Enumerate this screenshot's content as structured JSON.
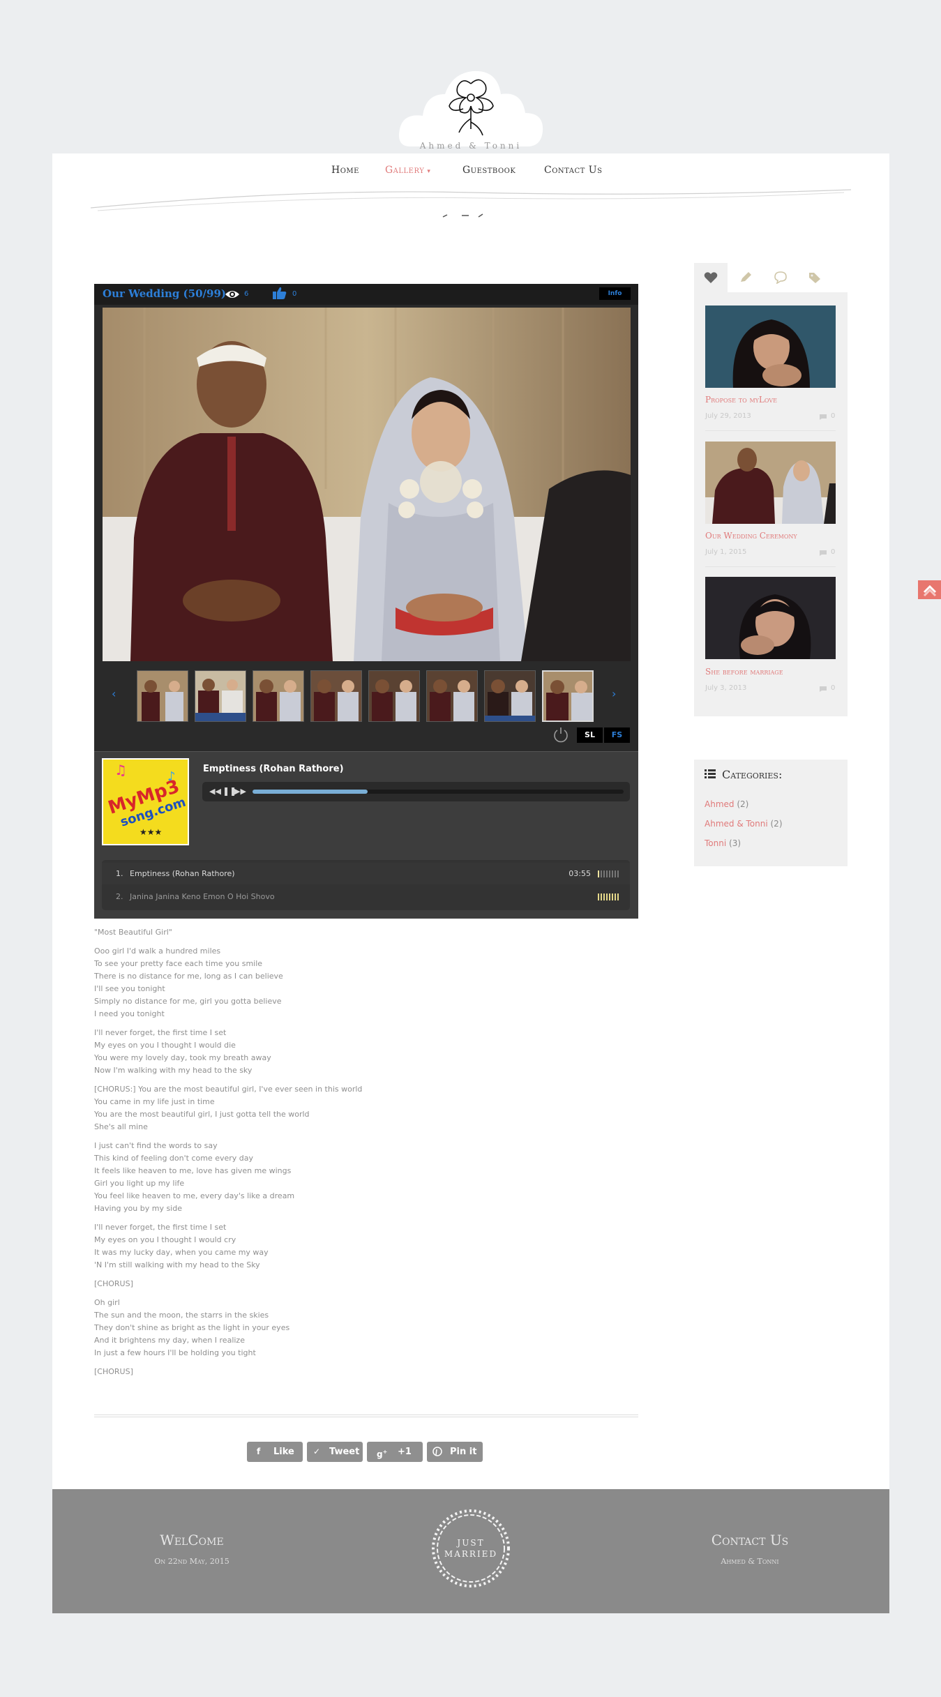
{
  "header": {
    "logo_text": "Ahmed & Tonni"
  },
  "nav": {
    "items": [
      {
        "label": "Home"
      },
      {
        "label": "Gallery"
      },
      {
        "label": "Guestbook"
      },
      {
        "label": "Contact Us"
      }
    ],
    "active_item": "Gallery"
  },
  "gallery": {
    "title": "Our Wedding (50/99)",
    "views": "6",
    "likes": "0",
    "info_label": "Info",
    "slideshow_label": "SL",
    "fullscreen_label": "FS",
    "thumbnail_count": 8,
    "active_thumbnail": 8
  },
  "player": {
    "current_track": "Emptiness (Rohan Rathore)",
    "album_art_text": "MyMp3song.com",
    "progress": 0.31,
    "playlist": [
      {
        "num": "1.",
        "name": "Emptiness (Rohan Rathore)",
        "time": "03:55"
      },
      {
        "num": "2.",
        "name": "Janina Janina Keno Emon O Hoi Shovo",
        "time": ""
      }
    ]
  },
  "lyrics": {
    "song_name": "\"Most Beautiful Girl\"",
    "stanzas": [
      [
        "Ooo girl I'd walk a hundred miles",
        "To see your pretty face each time you smile",
        "There is no distance for me, long as I can believe",
        "I'll see you tonight",
        "Simply no distance for me, girl you gotta believe",
        "I need you tonight"
      ],
      [
        "I'll never forget, the first time I set",
        "My eyes on you I thought I would die",
        "You were my lovely day, took my breath away",
        "Now I'm walking with my head to the sky"
      ],
      [
        "[CHORUS:] You are the most beautiful girl, I've ever seen in this world",
        "You came in my life just in time",
        "You are the most beautiful girl, I just gotta tell the world",
        "She's all mine"
      ],
      [
        "I just can't find the words to say",
        "This kind of feeling don't come every day",
        "It feels like heaven to me, love has given me wings",
        "Girl you light up my life",
        "You feel like heaven to me, every day's like a dream",
        "Having you by my side"
      ],
      [
        "I'll never forget, the first time I set",
        "My eyes on you I thought I would cry",
        "It was my lucky day, when you came my way",
        "'N I'm still walking with my head to the Sky"
      ],
      [
        "[CHORUS]"
      ],
      [
        "Oh girl",
        "The sun and the moon, the starrs in the skies",
        "They don't shine as bright as the light in your eyes",
        "And it brightens my day, when I realize",
        "In just a few hours I'll be holding you tight"
      ],
      [
        "[CHORUS]"
      ]
    ]
  },
  "share": {
    "like": "Like",
    "tweet": "Tweet",
    "plus": "+1",
    "pin": "Pin it"
  },
  "sidebar": {
    "tabs": [
      "heart-icon",
      "pencil-icon",
      "comment-icon",
      "tags-icon"
    ],
    "posts": [
      {
        "title": "Propose to myLove",
        "date": "July 29, 2013",
        "comments": "0"
      },
      {
        "title": "Our Wedding Ceremony",
        "date": "July 1, 2015",
        "comments": "0"
      },
      {
        "title": "She before marriage",
        "date": "July 3, 2013",
        "comments": "0"
      }
    ],
    "categories_title": "Categories:",
    "categories": [
      {
        "name": "Ahmed",
        "count": "(2)"
      },
      {
        "name": "Ahmed & Tonni",
        "count": "(2)"
      },
      {
        "name": "Tonni",
        "count": "(3)"
      }
    ]
  },
  "footer": {
    "left_title": "WelCome",
    "left_sub": "On 22nd May, 2015",
    "wreath_text_line1": "JUST",
    "wreath_text_line2": "MARRIED",
    "right_title": "Contact Us",
    "right_sub": "Ahmed & Tonni"
  },
  "colors": {
    "accent": "#e07a7a",
    "link_blue": "#2d7fd8",
    "footer_bg": "#8a8a8a"
  }
}
